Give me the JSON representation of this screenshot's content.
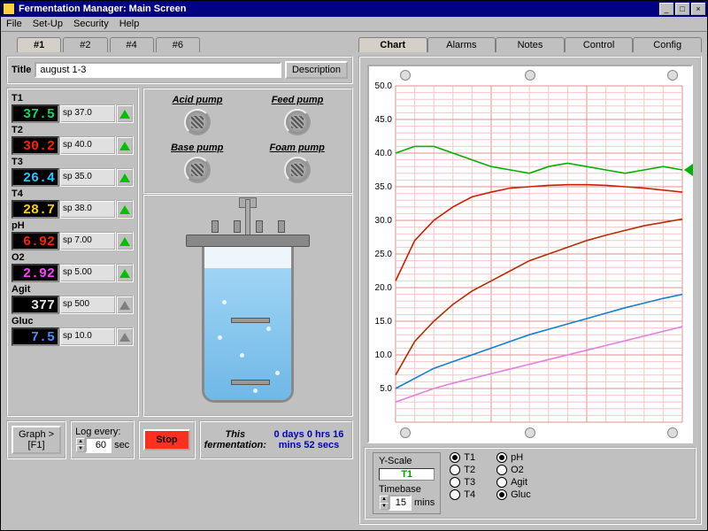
{
  "window": {
    "title": "Fermentation Manager: Main Screen"
  },
  "menu": {
    "file": "File",
    "setup": "Set-Up",
    "security": "Security",
    "help": "Help"
  },
  "left_tabs": {
    "t1": "#1",
    "t2": "#2",
    "t3": "#4",
    "t4": "#6"
  },
  "title_row": {
    "label": "Title",
    "value": "august 1-3",
    "desc_btn": "Description"
  },
  "readings": [
    {
      "name": "T1",
      "value": "37.5",
      "color": "#00e060",
      "sp": "sp 37.0",
      "tri": "green"
    },
    {
      "name": "T2",
      "value": "30.2",
      "color": "#ff2000",
      "sp": "sp 40.0",
      "tri": "green"
    },
    {
      "name": "T3",
      "value": "26.4",
      "color": "#20c8ff",
      "sp": "sp 35.0",
      "tri": "green"
    },
    {
      "name": "T4",
      "value": "28.7",
      "color": "#ffd000",
      "sp": "sp 38.0",
      "tri": "green"
    },
    {
      "name": "pH",
      "value": "6.92",
      "color": "#ff2000",
      "sp": "sp 7.00",
      "tri": "green"
    },
    {
      "name": "O2",
      "value": "2.92",
      "color": "#ff40ff",
      "sp": "sp 5.00",
      "tri": "green"
    },
    {
      "name": "Agit",
      "value": "377",
      "color": "#e8e8e8",
      "sp": "sp 500",
      "tri": "grey"
    },
    {
      "name": "Gluc",
      "value": "7.5",
      "color": "#4090ff",
      "sp": "sp 10.0",
      "tri": "grey"
    }
  ],
  "pumps": {
    "acid": "Acid pump",
    "feed": "Feed pump",
    "base": "Base pump",
    "foam": "Foam pump"
  },
  "footer": {
    "graph_btn_l1": "Graph >",
    "graph_btn_l2": "[F1]",
    "log_label": "Log every:",
    "log_value": "60",
    "log_unit": "sec",
    "stop": "Stop",
    "ferm_hdr": "This fermentation:",
    "ferm_val": "0 days 0 hrs 16 mins 52 secs"
  },
  "right_tabs": {
    "chart": "Chart",
    "alarms": "Alarms",
    "notes": "Notes",
    "control": "Control",
    "config": "Config"
  },
  "chart_ctrl": {
    "yscale_label": "Y-Scale",
    "yscale_value": "T1",
    "timebase_label": "Timebase",
    "timebase_value": "15",
    "timebase_unit": "mins",
    "radios": {
      "t1": "T1",
      "t2": "T2",
      "t3": "T3",
      "t4": "T4",
      "ph": "pH",
      "o2": "O2",
      "agit": "Agit",
      "gluc": "Gluc"
    },
    "selected": [
      "t1",
      "ph",
      "gluc"
    ]
  },
  "chart_data": {
    "type": "line",
    "xlabel": "",
    "ylabel": "",
    "ylim": [
      0,
      50
    ],
    "yticks": [
      5,
      10,
      15,
      20,
      25,
      30,
      35,
      40,
      45,
      50
    ],
    "x_range_mins": [
      0,
      15
    ],
    "cursor_y": 37.5,
    "series": [
      {
        "name": "T1",
        "color": "#00b000",
        "x": [
          0,
          1,
          2,
          3,
          4,
          5,
          6,
          7,
          8,
          9,
          10,
          11,
          12,
          13,
          14,
          15
        ],
        "y": [
          40,
          41,
          41,
          40,
          39,
          38,
          37.5,
          37,
          38,
          38.5,
          38,
          37.5,
          37,
          37.5,
          38,
          37.5
        ]
      },
      {
        "name": "T2",
        "color": "#cc2000",
        "x": [
          0,
          1,
          2,
          3,
          4,
          5,
          6,
          7,
          8,
          9,
          10,
          11,
          12,
          13,
          14,
          15
        ],
        "y": [
          21,
          27,
          30,
          32,
          33.5,
          34.2,
          34.8,
          35,
          35.2,
          35.3,
          35.3,
          35.2,
          35,
          34.8,
          34.5,
          34.2
        ]
      },
      {
        "name": "T3",
        "color": "#b03000",
        "x": [
          0,
          1,
          2,
          3,
          4,
          5,
          6,
          7,
          8,
          9,
          10,
          11,
          12,
          13,
          14,
          15
        ],
        "y": [
          7,
          12,
          15,
          17.5,
          19.5,
          21,
          22.5,
          24,
          25,
          26,
          27,
          27.8,
          28.5,
          29.2,
          29.7,
          30.2
        ]
      },
      {
        "name": "O2",
        "color": "#1080d0",
        "x": [
          0,
          1,
          2,
          3,
          4,
          5,
          6,
          7,
          8,
          9,
          10,
          11,
          12,
          13,
          14,
          15
        ],
        "y": [
          5,
          6.5,
          8,
          9,
          10,
          11,
          12,
          13,
          13.8,
          14.6,
          15.4,
          16.2,
          17,
          17.7,
          18.4,
          19
        ]
      },
      {
        "name": "Gluc",
        "color": "#e080e0",
        "x": [
          0,
          1,
          2,
          3,
          4,
          5,
          6,
          7,
          8,
          9,
          10,
          11,
          12,
          13,
          14,
          15
        ],
        "y": [
          3,
          4,
          5,
          5.8,
          6.5,
          7.2,
          7.9,
          8.6,
          9.3,
          10,
          10.7,
          11.4,
          12.1,
          12.8,
          13.5,
          14.2
        ]
      }
    ]
  }
}
